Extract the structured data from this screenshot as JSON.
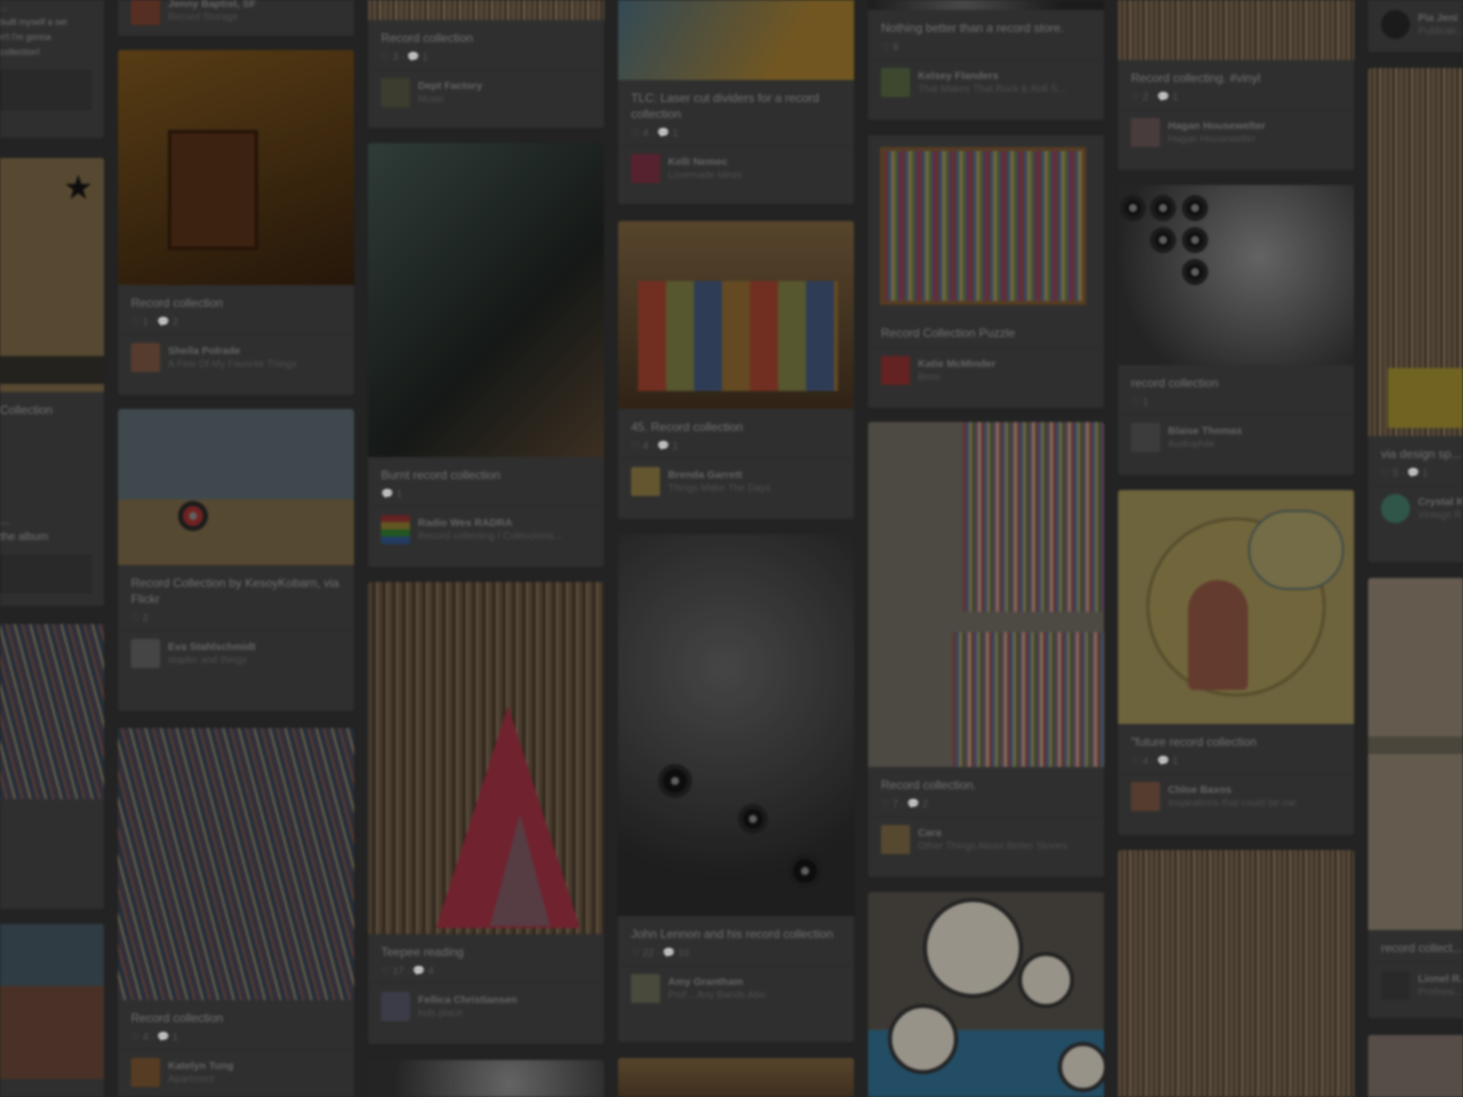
{
  "pins": [
    {
      "col": "col0",
      "desc": "...\nbuilt myself a set\nn't I'm gonna\ncollection!",
      "stats": "",
      "name": "",
      "board": ""
    },
    {
      "col": "col0",
      "desc": "Collection",
      "stats": "",
      "name": "",
      "board": ""
    },
    {
      "col": "col0",
      "desc": "...\nthe album",
      "stats": "",
      "name": "",
      "board": ""
    },
    {
      "col": "col1",
      "desc": "",
      "stats": "",
      "name": "Jenny Baptist, SF",
      "board": "Record Storage"
    },
    {
      "col": "col1",
      "desc": "Record collection",
      "stats": "♡ 1 · 💬 2",
      "name": "Sheila Polrade",
      "board": "A Few Of My Favorite Things"
    },
    {
      "col": "col1",
      "desc": "Record Collection by KesoyKobarn, via Flickr",
      "stats": "♡ 2",
      "name": "Eva Stahlschmidt",
      "board": "stapler and things"
    },
    {
      "col": "col1",
      "desc": "Record collection",
      "stats": "♡ 4 · 💬 1",
      "name": "Katelyn Tung",
      "board": "Apartment"
    },
    {
      "col": "col2",
      "desc": "Record collection",
      "stats": "♡ 3 · 💬 1",
      "name": "Dept Factory",
      "board": "Music"
    },
    {
      "col": "col2",
      "desc": "Burnt record collection",
      "stats": "💬 1",
      "name": "Radio Wes RADRA",
      "board": "Record collecting / Coleccionis..."
    },
    {
      "col": "col2",
      "desc": "Teepee reading",
      "stats": "♡ 17 · 💬 4",
      "name": "Fellica Christiansen",
      "board": "kids place"
    },
    {
      "col": "col3",
      "desc": "TLC: Laser cut dividers for a record collection",
      "stats": "♡ 4 · 💬 1",
      "name": "Kelli Nemec",
      "board": "Lovemade Ideas"
    },
    {
      "col": "col3",
      "desc": "45. Record collection",
      "stats": "♡ 4 · 💬 1",
      "name": "Brenda Garrett",
      "board": "Things Make The Days"
    },
    {
      "col": "col3",
      "desc": "John Lennon and his record collection",
      "stats": "♡ 22 · 💬 10",
      "name": "Amy Grantham",
      "board": "Prof... Any Bands Abo"
    },
    {
      "col": "col4",
      "desc": "Nothing better than a record store.",
      "stats": "♡ 8",
      "name": "Kelsey Flanders",
      "board": "That Makes That Rock & Roll S..."
    },
    {
      "col": "col4",
      "desc": "Record Collection Puzzle",
      "stats": "",
      "name": "Katie McMinder",
      "board": "Boss"
    },
    {
      "col": "col4",
      "desc": "Record collection.",
      "stats": "♡ 7 · 💬 2",
      "name": "Cara",
      "board": "Other Things About Better Stories"
    },
    {
      "col": "col5",
      "desc": "Record collecting. #vinyl",
      "stats": "♡ 2 · 💬 1",
      "name": "Hagan Housewelter",
      "board": "Hagan Housewelter"
    },
    {
      "col": "col5",
      "desc": "record collection",
      "stats": "♡ 1",
      "name": "Blaise Thomas",
      "board": "Audiophile"
    },
    {
      "col": "col5",
      "desc": "\"future record collection",
      "stats": "♡ 4 · 💬 1",
      "name": "Chloe Baxos",
      "board": "Inspirations that could be me"
    },
    {
      "col": "col6",
      "desc": "",
      "stats": "",
      "name": "Pia Jeni",
      "board": "Publicati..."
    },
    {
      "col": "col6",
      "desc": "via design sp... and bookcase...",
      "stats": "♡ 5 · 💬 1",
      "name": "Crystal K",
      "board": "Vintage R..."
    },
    {
      "col": "col6",
      "desc": "record collect...",
      "stats": "",
      "name": "Lionel R...",
      "board": "Professi..."
    }
  ]
}
